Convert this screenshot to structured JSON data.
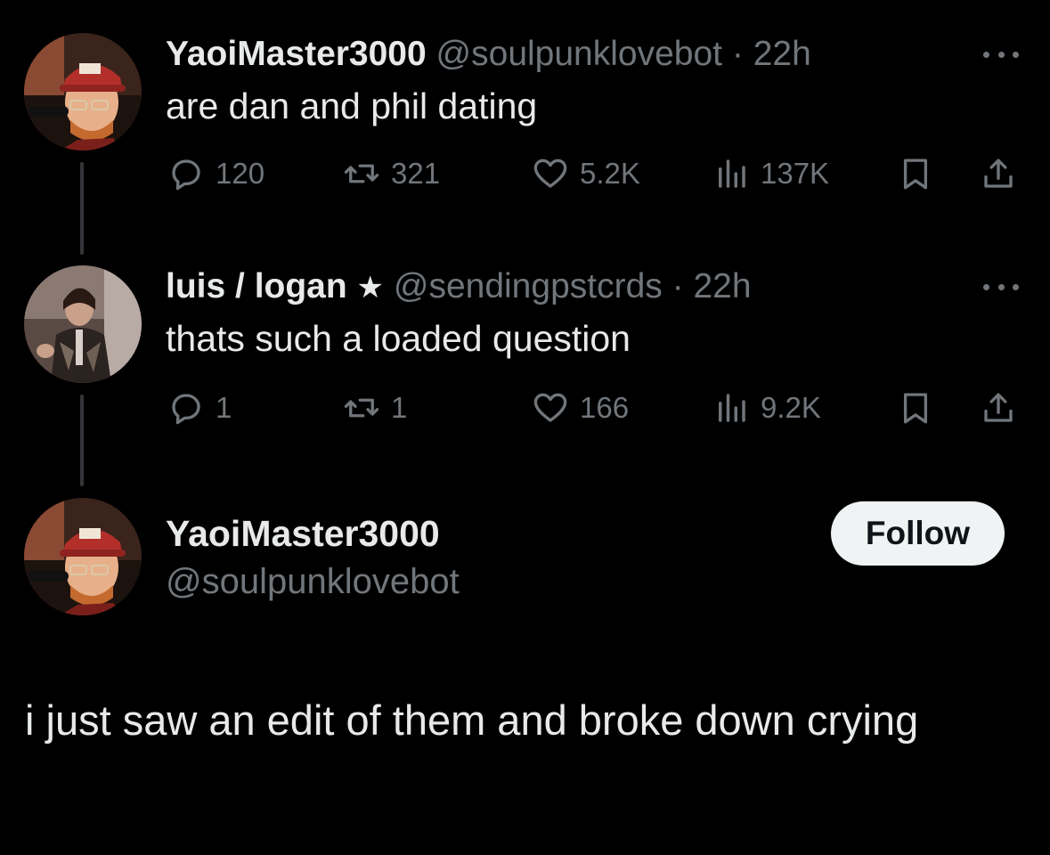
{
  "tweets": [
    {
      "display_name": "YaoiMaster3000",
      "handle": "@soulpunklovebot",
      "separator": "·",
      "time": "22h",
      "text": "are dan and phil dating",
      "avatar_icon": "avatar-red-cap-photo",
      "stats": {
        "replies": "120",
        "reposts": "321",
        "likes": "5.2K",
        "views": "137K"
      }
    },
    {
      "display_name": "luis / logan",
      "badge": "★",
      "handle": "@sendingpstcrds",
      "separator": "·",
      "time": "22h",
      "text": "thats such a loaded question",
      "avatar_icon": "avatar-performer-photo",
      "stats": {
        "replies": "1",
        "reposts": "1",
        "likes": "166",
        "views": "9.2K"
      }
    }
  ],
  "main_tweet": {
    "display_name": "YaoiMaster3000",
    "handle": "@soulpunklovebot",
    "follow_label": "Follow",
    "text": "i just saw an edit of them and broke down crying",
    "avatar_icon": "avatar-red-cap-photo"
  },
  "icons": {
    "reply": "reply-icon",
    "repost": "repost-icon",
    "like": "heart-icon",
    "views": "views-chart-icon",
    "bookmark": "bookmark-icon",
    "share": "share-icon",
    "more": "more-dots-icon"
  },
  "colors": {
    "background": "#000000",
    "primary_text": "#e7e9ea",
    "secondary_text": "#71767b",
    "thread_line": "#333639",
    "follow_button_bg": "#eff3f4",
    "follow_button_text": "#0f1419"
  }
}
